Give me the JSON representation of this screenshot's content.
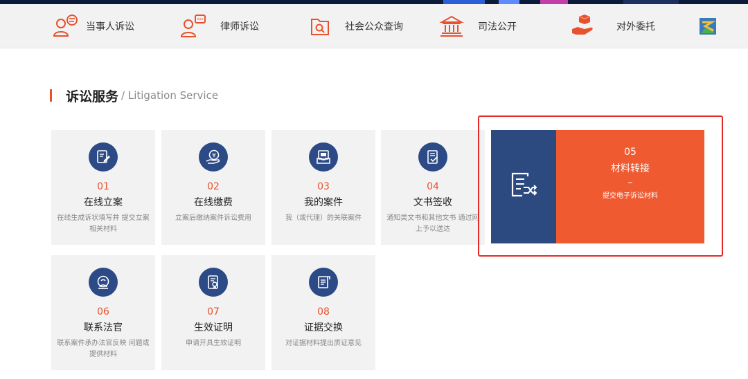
{
  "nav": {
    "items": [
      {
        "label": "当事人诉讼",
        "icon": "user-chat-icon"
      },
      {
        "label": "律师诉讼",
        "icon": "lawyer-chat-icon"
      },
      {
        "label": "社会公众查询",
        "icon": "search-folder-icon"
      },
      {
        "label": "司法公开",
        "icon": "courthouse-icon"
      },
      {
        "label": "对外委托",
        "icon": "hand-box-icon"
      },
      {
        "label": "",
        "icon": "app-logo-icon"
      }
    ]
  },
  "section": {
    "title_zh": "诉讼服务",
    "title_en": "/ Litigation Service"
  },
  "services": [
    {
      "num": "01",
      "title": "在线立案",
      "desc": "在线生成诉状填写并 提交立案相关材料",
      "icon": "edit-document-icon"
    },
    {
      "num": "02",
      "title": "在线缴费",
      "desc": "立案后缴纳案件诉讼费用",
      "icon": "yuan-payment-icon"
    },
    {
      "num": "03",
      "title": "我的案件",
      "desc": "我（或代理）的关联案件",
      "icon": "case-file-icon"
    },
    {
      "num": "04",
      "title": "文书签收",
      "desc": "通知类文书和其他文书 通过网上予以送达",
      "icon": "document-sign-icon"
    },
    {
      "num": "06",
      "title": "联系法官",
      "desc": "联系案件承办法官反映 问题或提供材料",
      "icon": "contact-judge-icon"
    },
    {
      "num": "07",
      "title": "生效证明",
      "desc": "申请开具生效证明",
      "icon": "certificate-icon"
    },
    {
      "num": "08",
      "title": "证据交换",
      "desc": "对证据材料提出质证意见",
      "icon": "evidence-exchange-icon"
    }
  ],
  "featured": {
    "num": "05",
    "title": "材料转接",
    "dash": "–",
    "desc": "提交电子诉讼材料",
    "icon": "material-transfer-icon"
  },
  "colors": {
    "accent": "#e8512d",
    "navy": "#2b4a86",
    "highlight": "#e52929"
  }
}
